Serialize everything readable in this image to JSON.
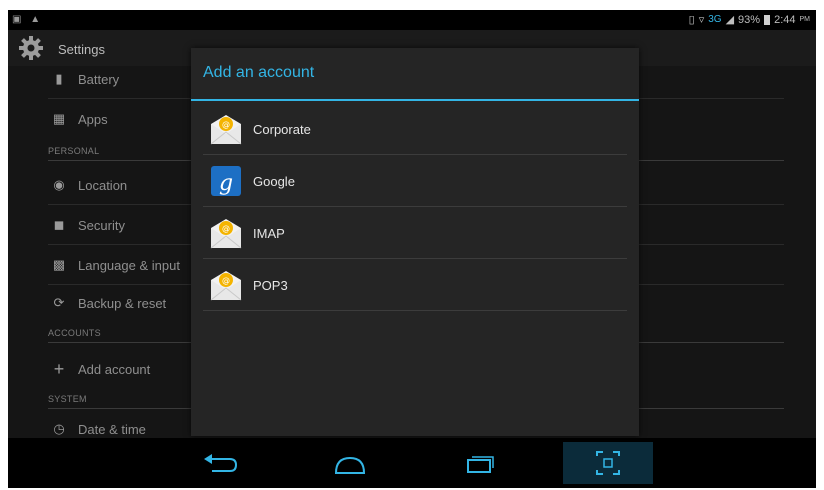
{
  "status_bar": {
    "left_icons": [
      "screen-icon",
      "notification-icon"
    ],
    "network": "3G",
    "battery_percent": "93%",
    "time": "2:44",
    "ampm": "PM"
  },
  "settings": {
    "title": "Settings",
    "items": [
      {
        "label": "Battery",
        "icon": "battery-icon"
      },
      {
        "label": "Apps",
        "icon": "apps-icon"
      },
      {
        "label": "Location",
        "icon": "location-icon"
      },
      {
        "label": "Security",
        "icon": "lock-icon"
      },
      {
        "label": "Language & input",
        "icon": "language-icon"
      },
      {
        "label": "Backup & reset",
        "icon": "backup-icon"
      },
      {
        "label": "Add account",
        "icon": "plus-icon"
      },
      {
        "label": "Date & time",
        "icon": "clock-icon"
      }
    ],
    "sections": {
      "personal": "PERSONAL",
      "accounts": "ACCOUNTS",
      "system": "SYSTEM"
    }
  },
  "dialog": {
    "title": "Add an account",
    "accounts": [
      {
        "label": "Corporate",
        "icon": "email-envelope-icon"
      },
      {
        "label": "Google",
        "icon": "google-icon"
      },
      {
        "label": "IMAP",
        "icon": "email-envelope-icon"
      },
      {
        "label": "POP3",
        "icon": "email-envelope-icon"
      }
    ]
  },
  "colors": {
    "accent": "#33b5e5",
    "dialog_bg": "#252525",
    "background": "#151515"
  },
  "nav_bar": [
    "back-icon",
    "home-icon",
    "recent-apps-icon",
    "screenshot-icon"
  ]
}
